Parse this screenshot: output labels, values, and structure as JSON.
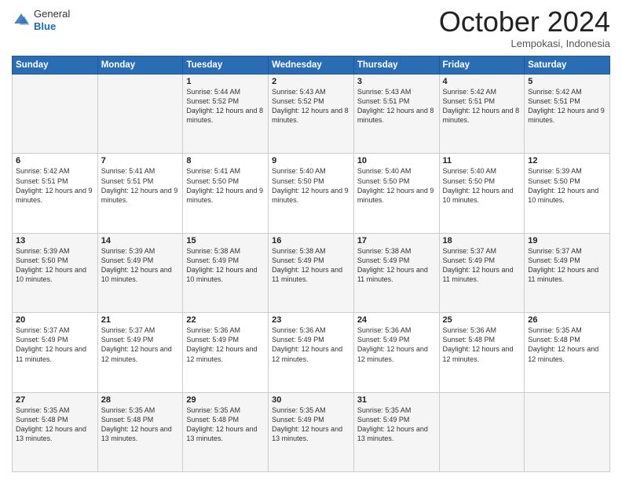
{
  "header": {
    "logo": {
      "general": "General",
      "blue": "Blue"
    },
    "title": "October 2024",
    "location": "Lempokasi, Indonesia"
  },
  "days_of_week": [
    "Sunday",
    "Monday",
    "Tuesday",
    "Wednesday",
    "Thursday",
    "Friday",
    "Saturday"
  ],
  "weeks": [
    [
      {
        "day": null,
        "info": null
      },
      {
        "day": null,
        "info": null
      },
      {
        "day": "1",
        "info": "Sunrise: 5:44 AM\nSunset: 5:52 PM\nDaylight: 12 hours and 8 minutes."
      },
      {
        "day": "2",
        "info": "Sunrise: 5:43 AM\nSunset: 5:52 PM\nDaylight: 12 hours and 8 minutes."
      },
      {
        "day": "3",
        "info": "Sunrise: 5:43 AM\nSunset: 5:51 PM\nDaylight: 12 hours and 8 minutes."
      },
      {
        "day": "4",
        "info": "Sunrise: 5:42 AM\nSunset: 5:51 PM\nDaylight: 12 hours and 8 minutes."
      },
      {
        "day": "5",
        "info": "Sunrise: 5:42 AM\nSunset: 5:51 PM\nDaylight: 12 hours and 9 minutes."
      }
    ],
    [
      {
        "day": "6",
        "info": "Sunrise: 5:42 AM\nSunset: 5:51 PM\nDaylight: 12 hours and 9 minutes."
      },
      {
        "day": "7",
        "info": "Sunrise: 5:41 AM\nSunset: 5:51 PM\nDaylight: 12 hours and 9 minutes."
      },
      {
        "day": "8",
        "info": "Sunrise: 5:41 AM\nSunset: 5:50 PM\nDaylight: 12 hours and 9 minutes."
      },
      {
        "day": "9",
        "info": "Sunrise: 5:40 AM\nSunset: 5:50 PM\nDaylight: 12 hours and 9 minutes."
      },
      {
        "day": "10",
        "info": "Sunrise: 5:40 AM\nSunset: 5:50 PM\nDaylight: 12 hours and 9 minutes."
      },
      {
        "day": "11",
        "info": "Sunrise: 5:40 AM\nSunset: 5:50 PM\nDaylight: 12 hours and 10 minutes."
      },
      {
        "day": "12",
        "info": "Sunrise: 5:39 AM\nSunset: 5:50 PM\nDaylight: 12 hours and 10 minutes."
      }
    ],
    [
      {
        "day": "13",
        "info": "Sunrise: 5:39 AM\nSunset: 5:50 PM\nDaylight: 12 hours and 10 minutes."
      },
      {
        "day": "14",
        "info": "Sunrise: 5:39 AM\nSunset: 5:49 PM\nDaylight: 12 hours and 10 minutes."
      },
      {
        "day": "15",
        "info": "Sunrise: 5:38 AM\nSunset: 5:49 PM\nDaylight: 12 hours and 10 minutes."
      },
      {
        "day": "16",
        "info": "Sunrise: 5:38 AM\nSunset: 5:49 PM\nDaylight: 12 hours and 11 minutes."
      },
      {
        "day": "17",
        "info": "Sunrise: 5:38 AM\nSunset: 5:49 PM\nDaylight: 12 hours and 11 minutes."
      },
      {
        "day": "18",
        "info": "Sunrise: 5:37 AM\nSunset: 5:49 PM\nDaylight: 12 hours and 11 minutes."
      },
      {
        "day": "19",
        "info": "Sunrise: 5:37 AM\nSunset: 5:49 PM\nDaylight: 12 hours and 11 minutes."
      }
    ],
    [
      {
        "day": "20",
        "info": "Sunrise: 5:37 AM\nSunset: 5:49 PM\nDaylight: 12 hours and 11 minutes."
      },
      {
        "day": "21",
        "info": "Sunrise: 5:37 AM\nSunset: 5:49 PM\nDaylight: 12 hours and 12 minutes."
      },
      {
        "day": "22",
        "info": "Sunrise: 5:36 AM\nSunset: 5:49 PM\nDaylight: 12 hours and 12 minutes."
      },
      {
        "day": "23",
        "info": "Sunrise: 5:36 AM\nSunset: 5:49 PM\nDaylight: 12 hours and 12 minutes."
      },
      {
        "day": "24",
        "info": "Sunrise: 5:36 AM\nSunset: 5:49 PM\nDaylight: 12 hours and 12 minutes."
      },
      {
        "day": "25",
        "info": "Sunrise: 5:36 AM\nSunset: 5:48 PM\nDaylight: 12 hours and 12 minutes."
      },
      {
        "day": "26",
        "info": "Sunrise: 5:35 AM\nSunset: 5:48 PM\nDaylight: 12 hours and 12 minutes."
      }
    ],
    [
      {
        "day": "27",
        "info": "Sunrise: 5:35 AM\nSunset: 5:48 PM\nDaylight: 12 hours and 13 minutes."
      },
      {
        "day": "28",
        "info": "Sunrise: 5:35 AM\nSunset: 5:48 PM\nDaylight: 12 hours and 13 minutes."
      },
      {
        "day": "29",
        "info": "Sunrise: 5:35 AM\nSunset: 5:48 PM\nDaylight: 12 hours and 13 minutes."
      },
      {
        "day": "30",
        "info": "Sunrise: 5:35 AM\nSunset: 5:49 PM\nDaylight: 12 hours and 13 minutes."
      },
      {
        "day": "31",
        "info": "Sunrise: 5:35 AM\nSunset: 5:49 PM\nDaylight: 12 hours and 13 minutes."
      },
      {
        "day": null,
        "info": null
      },
      {
        "day": null,
        "info": null
      }
    ]
  ]
}
